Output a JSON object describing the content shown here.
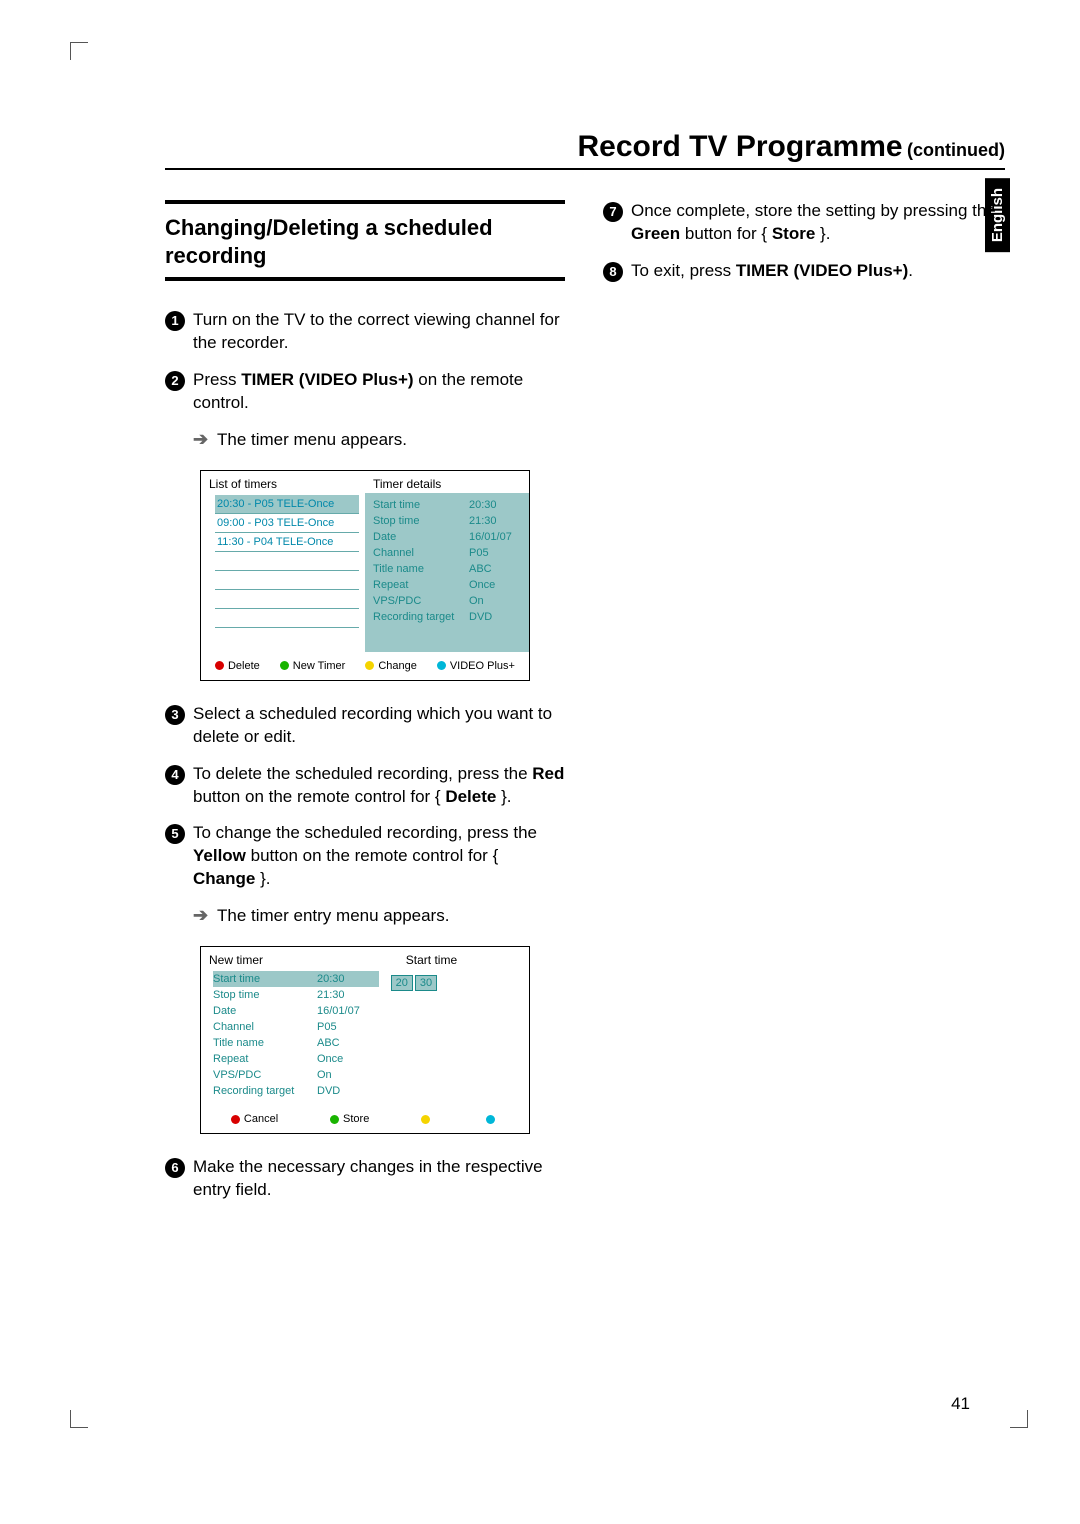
{
  "header": {
    "title": "Record TV Programme",
    "continued": "(continued)"
  },
  "subheading": "Changing/Deleting a scheduled recording",
  "steps_left": [
    {
      "n": "1",
      "pre": "Turn on the TV to the correct viewing channel for the recorder."
    },
    {
      "n": "2",
      "pre": "Press ",
      "bold": "TIMER (VIDEO Plus+)",
      "post": " on the remote control."
    },
    {
      "n": "3",
      "pre": "Select a scheduled recording which you want to delete or edit."
    },
    {
      "n": "4",
      "pre": "To delete the scheduled recording, press the ",
      "bold": "Red",
      "post": " button on the remote control for { ",
      "bold2": "Delete",
      "post2": " }."
    },
    {
      "n": "5",
      "pre": "To change the scheduled recording, press the ",
      "bold": "Yellow",
      "post": " button on the remote control for { ",
      "bold2": "Change",
      "post2": " }."
    },
    {
      "n": "6",
      "pre": "Make the necessary changes in the respective entry field."
    }
  ],
  "arrow1": "The timer menu appears.",
  "arrow2": "The timer entry menu appears.",
  "steps_right": [
    {
      "n": "7",
      "pre": "Once complete, store the setting by pressing the ",
      "bold": "Green",
      "post": " button for { ",
      "bold2": "Store",
      "post2": " }."
    },
    {
      "n": "8",
      "pre": "To exit, press ",
      "bold": "TIMER (VIDEO Plus+)",
      "post": "."
    }
  ],
  "osd1": {
    "h1": "List of timers",
    "h2": "Timer details",
    "rows": [
      "20:30 - P05 TELE-Once",
      "09:00 - P03 TELE-Once",
      "11:30 - P04 TELE-Once"
    ],
    "details": [
      {
        "k": "Start time",
        "v": "20:30"
      },
      {
        "k": "Stop time",
        "v": "21:30"
      },
      {
        "k": "Date",
        "v": "16/01/07"
      },
      {
        "k": "Channel",
        "v": "P05"
      },
      {
        "k": "Title name",
        "v": "ABC"
      },
      {
        "k": "Repeat",
        "v": "Once"
      },
      {
        "k": "VPS/PDC",
        "v": "On"
      },
      {
        "k": "Recording target",
        "v": "DVD"
      }
    ],
    "actions": [
      {
        "c": "r",
        "t": "Delete"
      },
      {
        "c": "g",
        "t": "New Timer"
      },
      {
        "c": "y",
        "t": "Change"
      },
      {
        "c": "c",
        "t": "VIDEO Plus+"
      }
    ]
  },
  "osd2": {
    "h1": "New timer",
    "h2": "Start time",
    "fields": [
      {
        "k": "Start time",
        "v": "20:30",
        "sel": true
      },
      {
        "k": "Stop time",
        "v": "21:30"
      },
      {
        "k": "Date",
        "v": "16/01/07"
      },
      {
        "k": "Channel",
        "v": "P05"
      },
      {
        "k": "Title name",
        "v": "ABC"
      },
      {
        "k": "Repeat",
        "v": "Once"
      },
      {
        "k": "VPS/PDC",
        "v": "On"
      },
      {
        "k": "Recording target",
        "v": "DVD"
      }
    ],
    "time_h": "20",
    "time_m": "30",
    "actions": [
      {
        "c": "r",
        "t": "Cancel"
      },
      {
        "c": "g",
        "t": "Store"
      },
      {
        "c": "y",
        "t": ""
      },
      {
        "c": "c",
        "t": ""
      }
    ]
  },
  "lang": "English",
  "page": "41"
}
